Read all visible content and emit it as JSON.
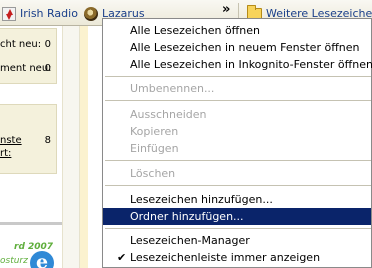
{
  "toolbar": {
    "items": [
      {
        "label": "Irish Radio",
        "icon": "irish-radio-favicon"
      },
      {
        "label": "Lazarus",
        "icon": "lazarus-favicon"
      }
    ],
    "overflow": "»",
    "folder_label": "Weitere Lesezeichen"
  },
  "page": {
    "panel1": [
      {
        "label": "cht neu:",
        "value": "0"
      },
      {
        "label": "ment neu:",
        "value": "0"
      }
    ],
    "panel2": [
      {
        "label": "",
        "value": "1"
      },
      {
        "label": "nste",
        "value": "8"
      },
      {
        "label": "rt:",
        "value": ""
      }
    ],
    "logo_line1": "rd 2007",
    "logo_line2": "osturz",
    "logo_letter": "e"
  },
  "menu": {
    "items": [
      {
        "label": "Alle Lesezeichen öffnen",
        "enabled": true
      },
      {
        "label": "Alle Lesezeichen in neuem Fenster öffnen",
        "enabled": true
      },
      {
        "label": "Alle Lesezeichen in Inkognito-Fenster öffnen",
        "enabled": true
      },
      {
        "label": "Umbenennen...",
        "enabled": false
      },
      {
        "label": "Ausschneiden",
        "enabled": false
      },
      {
        "label": "Kopieren",
        "enabled": false
      },
      {
        "label": "Einfügen",
        "enabled": false
      },
      {
        "label": "Löschen",
        "enabled": false
      },
      {
        "label": "Lesezeichen hinzufügen...",
        "enabled": true
      },
      {
        "label": "Ordner hinzufügen...",
        "enabled": true,
        "highlighted": true
      },
      {
        "label": "Lesezeichen-Manager",
        "enabled": true
      },
      {
        "label": "Lesezeichenleiste immer anzeigen",
        "enabled": true,
        "checked": true
      }
    ],
    "check_mark": "✔"
  },
  "colors": {
    "highlight": "#0a246a",
    "disabled_text": "#a5a5a5",
    "link": "#1a3f8a"
  }
}
